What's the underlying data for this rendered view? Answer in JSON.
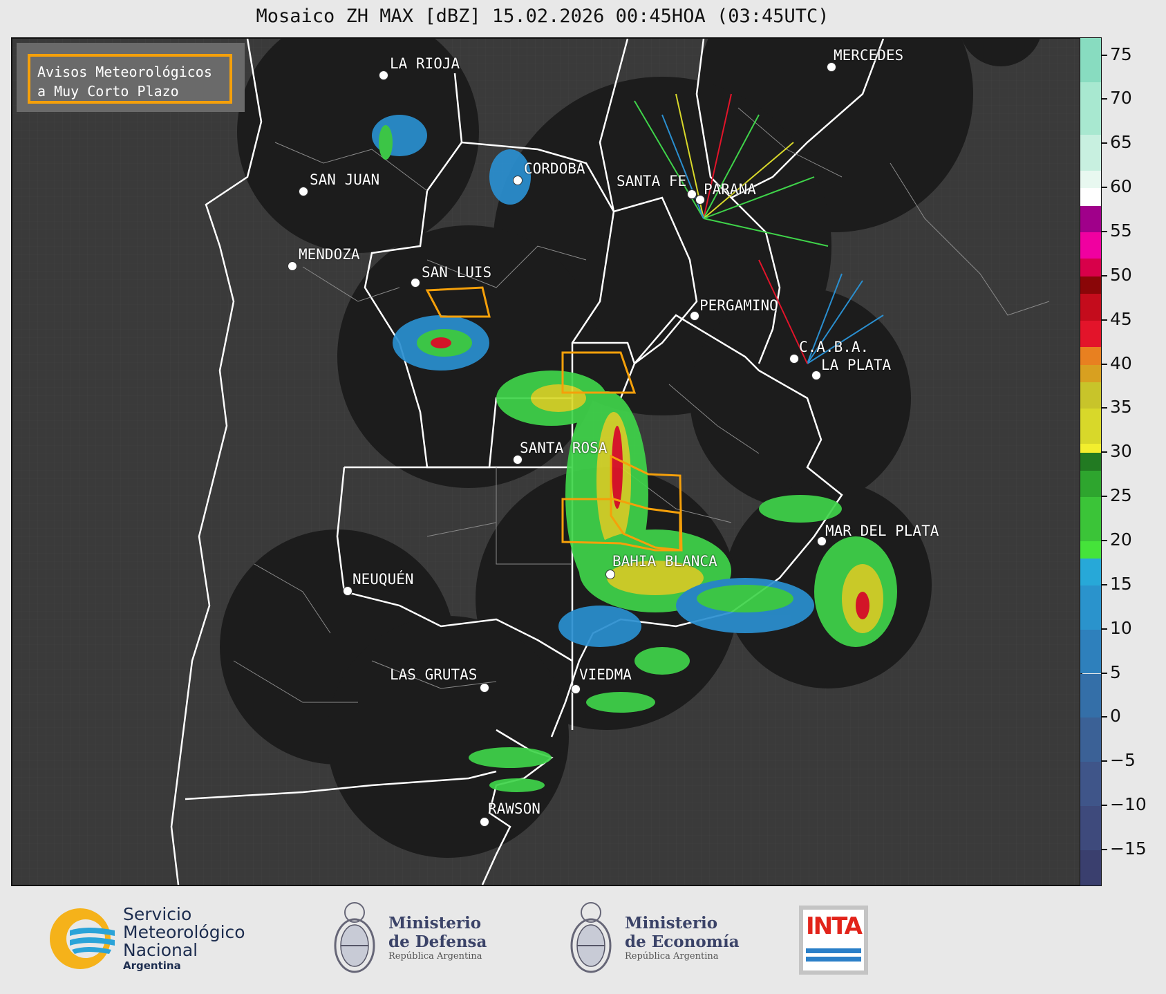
{
  "title": "Mosaico ZH MAX [dBZ] 15.02.2026 00:45HOA (03:45UTC)",
  "legend": {
    "line1": "Avisos Meteorológicos",
    "line2": "a Muy Corto Plazo",
    "border_color": "#f5a00a"
  },
  "cities": [
    {
      "name": "LA RIOJA"
    },
    {
      "name": "MERCEDES"
    },
    {
      "name": "SAN JUAN"
    },
    {
      "name": "CORDOBA"
    },
    {
      "name": "SANTA FE"
    },
    {
      "name": "PARANA"
    },
    {
      "name": "MENDOZA"
    },
    {
      "name": "SAN LUIS"
    },
    {
      "name": "PERGAMINO"
    },
    {
      "name": "C.A.B.A."
    },
    {
      "name": "LA PLATA"
    },
    {
      "name": "SANTA ROSA"
    },
    {
      "name": "MAR DEL PLATA"
    },
    {
      "name": "BAHIA BLANCA"
    },
    {
      "name": "NEUQUÉN"
    },
    {
      "name": "LAS GRUTAS"
    },
    {
      "name": "VIEDMA"
    },
    {
      "name": "RAWSON"
    }
  ],
  "colorbar": {
    "unit": "dBZ",
    "range": [
      -19,
      77
    ],
    "ticks": [
      "75",
      "70",
      "65",
      "60",
      "55",
      "50",
      "45",
      "40",
      "35",
      "30",
      "25",
      "20",
      "15",
      "10",
      "5",
      "0",
      "−5",
      "−10",
      "−15"
    ]
  },
  "logos": {
    "smn": {
      "line1": "Servicio",
      "line2": "Meteorológico",
      "line3": "Nacional",
      "line4": "Argentina"
    },
    "defensa": {
      "line1": "Ministerio",
      "line2": "de Defensa",
      "line3": "República Argentina"
    },
    "economia": {
      "line1": "Ministerio",
      "line2": "de Economía",
      "line3": "República Argentina"
    },
    "inta": {
      "text": "INTA"
    }
  },
  "colors": {
    "map_background": "#3a3a3a",
    "radar_coverage": "#1c1c1c",
    "province_border": "#ffffff",
    "warning_polygon": "#f5a00a"
  }
}
